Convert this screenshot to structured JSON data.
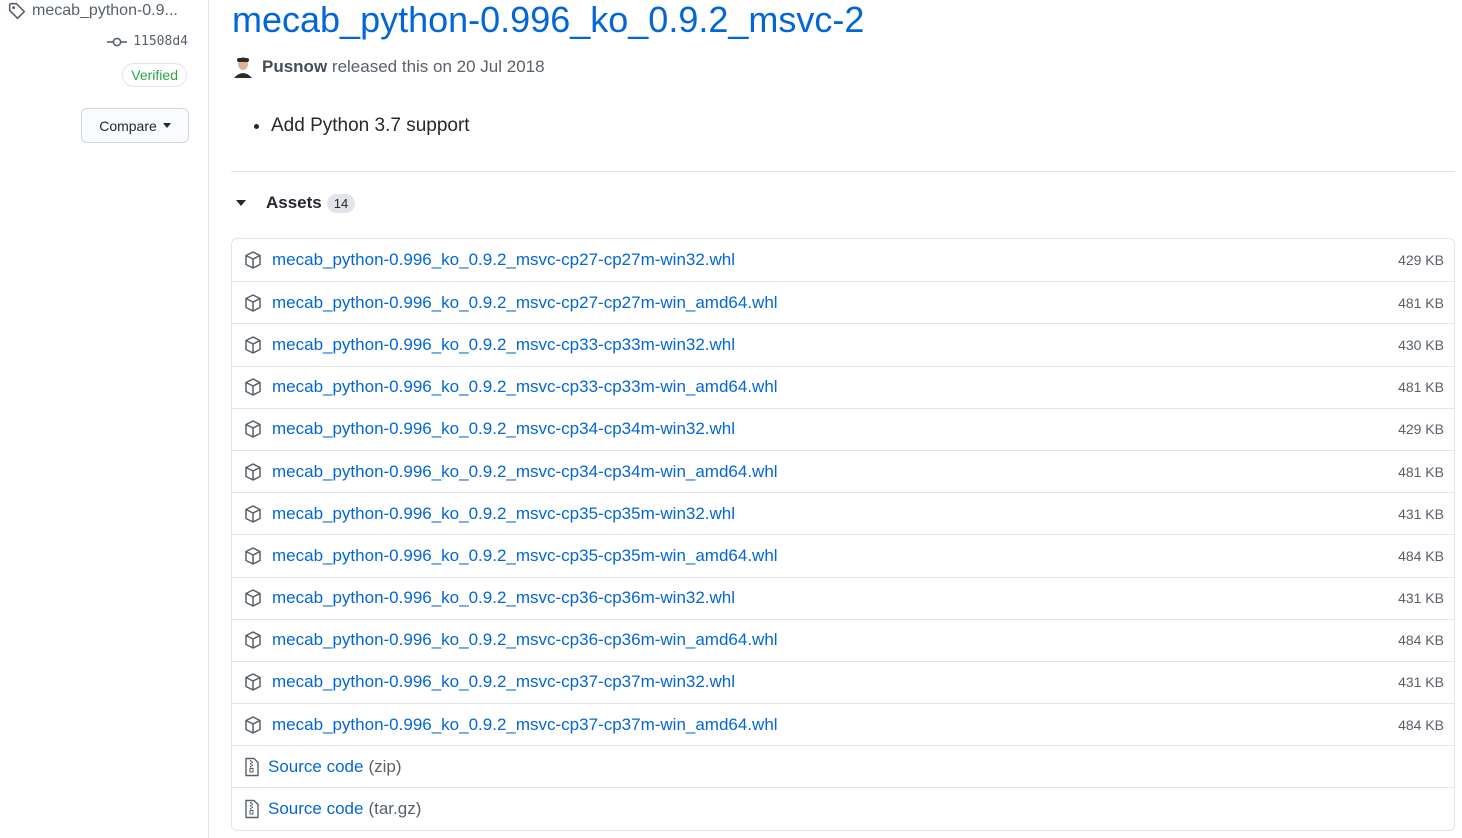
{
  "sidebar": {
    "tag": "mecab_python-0.9...",
    "commit": "11508d4",
    "verified": "Verified",
    "compare": "Compare"
  },
  "release": {
    "title": "mecab_python-0.996_ko_0.9.2_msvc-2",
    "author": "Pusnow",
    "released_text": "released this on 20 Jul 2018",
    "notes": [
      "Add Python 3.7 support"
    ]
  },
  "assets": {
    "label": "Assets",
    "count": "14",
    "files": [
      {
        "name": "mecab_python-0.996_ko_0.9.2_msvc-cp27-cp27m-win32.whl",
        "size": "429 KB"
      },
      {
        "name": "mecab_python-0.996_ko_0.9.2_msvc-cp27-cp27m-win_amd64.whl",
        "size": "481 KB"
      },
      {
        "name": "mecab_python-0.996_ko_0.9.2_msvc-cp33-cp33m-win32.whl",
        "size": "430 KB"
      },
      {
        "name": "mecab_python-0.996_ko_0.9.2_msvc-cp33-cp33m-win_amd64.whl",
        "size": "481 KB"
      },
      {
        "name": "mecab_python-0.996_ko_0.9.2_msvc-cp34-cp34m-win32.whl",
        "size": "429 KB"
      },
      {
        "name": "mecab_python-0.996_ko_0.9.2_msvc-cp34-cp34m-win_amd64.whl",
        "size": "481 KB"
      },
      {
        "name": "mecab_python-0.996_ko_0.9.2_msvc-cp35-cp35m-win32.whl",
        "size": "431 KB"
      },
      {
        "name": "mecab_python-0.996_ko_0.9.2_msvc-cp35-cp35m-win_amd64.whl",
        "size": "484 KB"
      },
      {
        "name": "mecab_python-0.996_ko_0.9.2_msvc-cp36-cp36m-win32.whl",
        "size": "431 KB"
      },
      {
        "name": "mecab_python-0.996_ko_0.9.2_msvc-cp36-cp36m-win_amd64.whl",
        "size": "484 KB"
      },
      {
        "name": "mecab_python-0.996_ko_0.9.2_msvc-cp37-cp37m-win32.whl",
        "size": "431 KB"
      },
      {
        "name": "mecab_python-0.996_ko_0.9.2_msvc-cp37-cp37m-win_amd64.whl",
        "size": "484 KB"
      }
    ],
    "source": [
      {
        "label": "Source code",
        "format": "(zip)"
      },
      {
        "label": "Source code",
        "format": "(tar.gz)"
      }
    ]
  },
  "colors": {
    "link": "#0366d6",
    "verified": "#28a745",
    "muted": "#586069",
    "border": "#e1e4e8"
  },
  "icons": {
    "tag": "tag-icon",
    "commit": "git-commit-icon",
    "asset": "package-icon",
    "source": "file-zip-icon"
  }
}
